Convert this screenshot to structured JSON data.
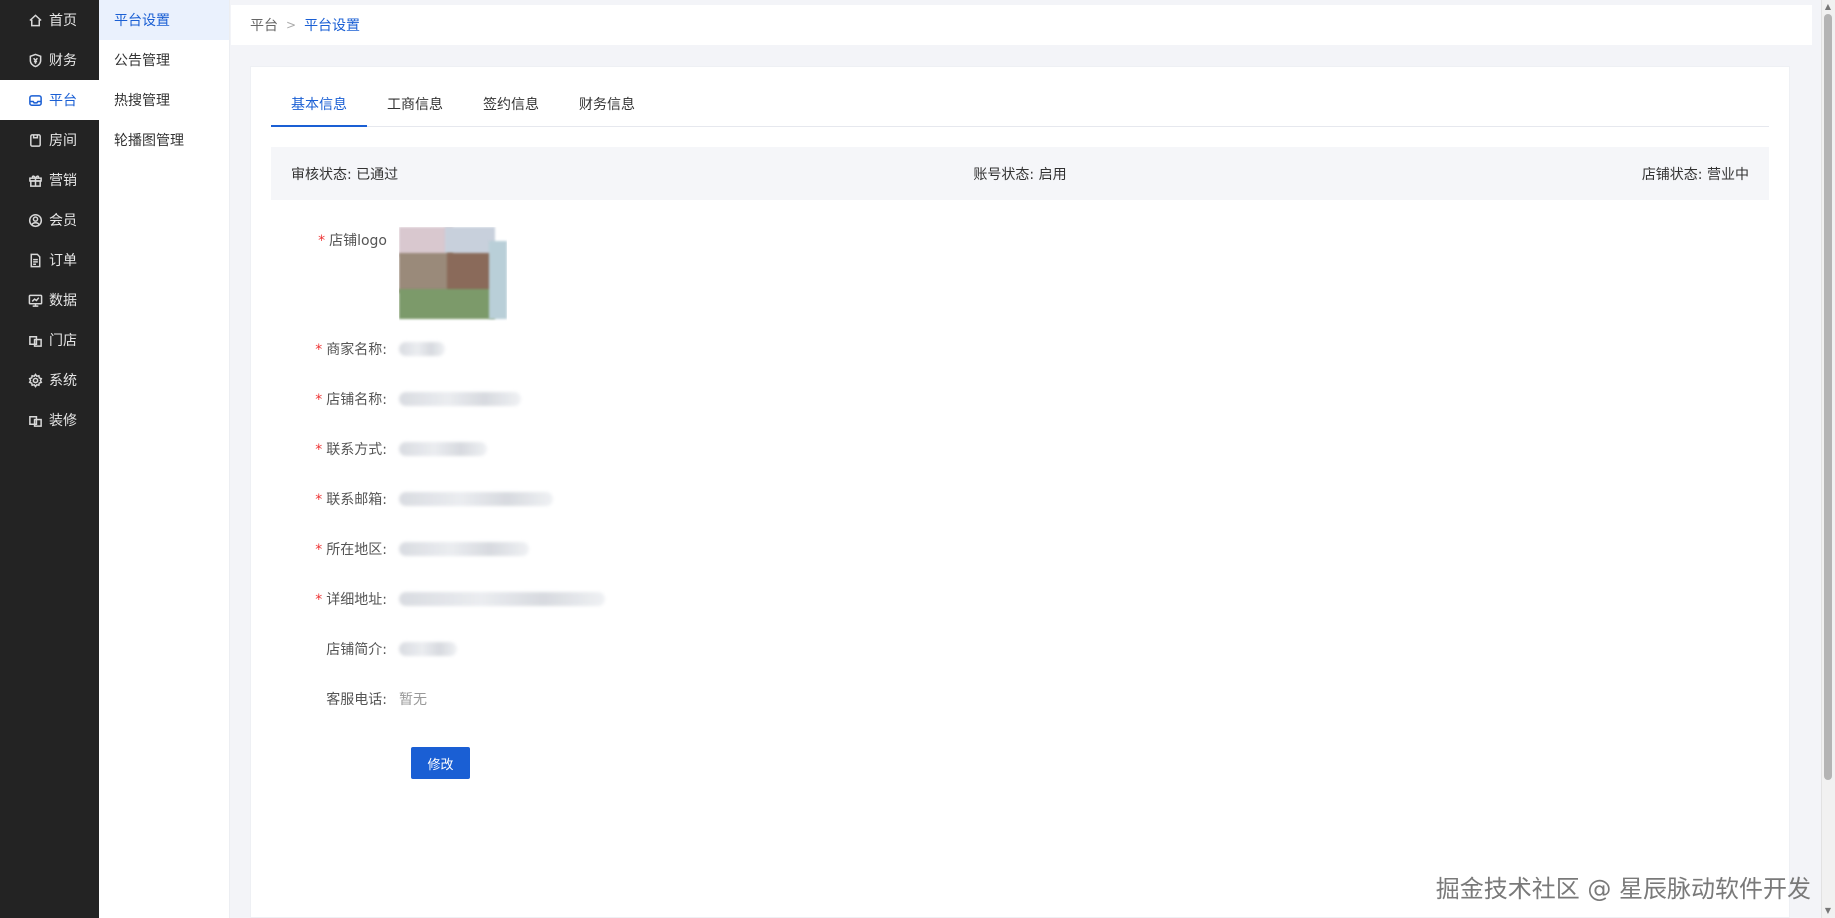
{
  "nav": {
    "items": [
      {
        "label": "首页",
        "icon": "home-icon"
      },
      {
        "label": "财务",
        "icon": "shield-yen-icon"
      },
      {
        "label": "平台",
        "icon": "platform-icon"
      },
      {
        "label": "房间",
        "icon": "room-icon"
      },
      {
        "label": "营销",
        "icon": "gift-icon"
      },
      {
        "label": "会员",
        "icon": "user-icon"
      },
      {
        "label": "订单",
        "icon": "document-icon"
      },
      {
        "label": "数据",
        "icon": "monitor-icon"
      },
      {
        "label": "门店",
        "icon": "store-icon"
      },
      {
        "label": "系统",
        "icon": "gear-icon"
      },
      {
        "label": "装修",
        "icon": "decorate-icon"
      }
    ],
    "active_index": 2
  },
  "submenu": {
    "items": [
      {
        "label": "平台设置"
      },
      {
        "label": "公告管理"
      },
      {
        "label": "热搜管理"
      },
      {
        "label": "轮播图管理"
      }
    ],
    "active_index": 0
  },
  "breadcrumb": {
    "root": "平台",
    "current": "平台设置"
  },
  "tabs": [
    {
      "label": "基本信息"
    },
    {
      "label": "工商信息"
    },
    {
      "label": "签约信息"
    },
    {
      "label": "财务信息"
    }
  ],
  "status": {
    "audit": "审核状态: 已通过",
    "account": "账号状态: 启用",
    "store": "店铺状态: 营业中"
  },
  "form": {
    "logo_label": "店铺logo",
    "merchant_label": "商家名称:",
    "store_label": "店铺名称:",
    "phone_label": "联系方式:",
    "email_label": "联系邮箱:",
    "region_label": "所在地区:",
    "address_label": "详细地址:",
    "intro_label": "店铺简介:",
    "service_label": "客服电话:",
    "service_value": "暂无",
    "required_mark": "*"
  },
  "edit_button": "修改",
  "watermark": "掘金技术社区 @ 星辰脉动软件开发",
  "colors": {
    "accent": "#1a5fd4",
    "nav_bg": "#232323",
    "required": "#e33333"
  }
}
